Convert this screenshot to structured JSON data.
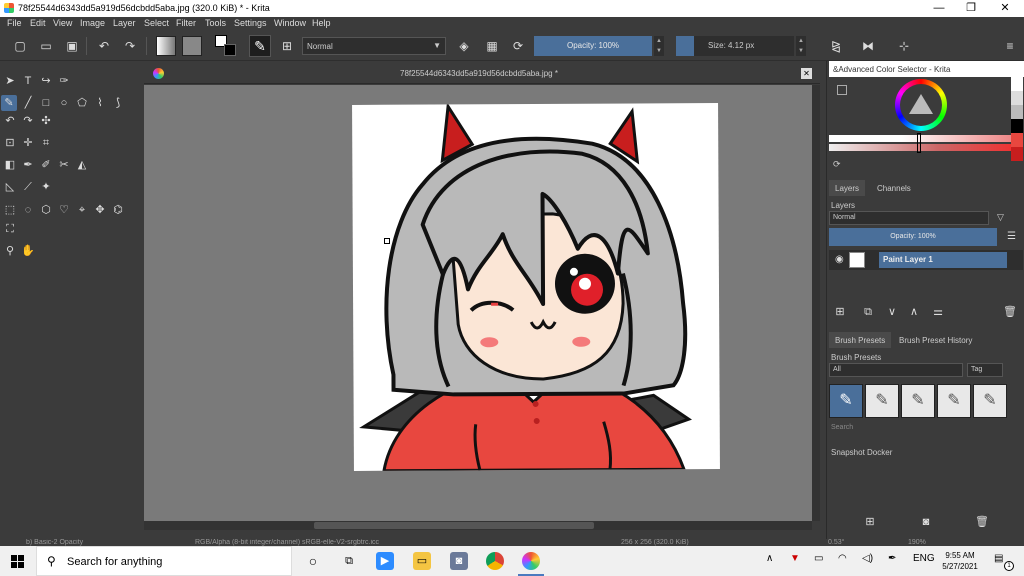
{
  "window": {
    "title": "78f25544d6343dd5a919d56dcbdd5aba.jpg (320.0 KiB)  * - Krita",
    "minimize": "—",
    "maximize": "❐",
    "close": "✕"
  },
  "menu": [
    "File",
    "Edit",
    "View",
    "Image",
    "Layer",
    "Select",
    "Filter",
    "Tools",
    "Settings",
    "Window",
    "Help"
  ],
  "toolbar": {
    "blend_mode": "Normal",
    "opacity": "Opacity: 100%",
    "size": "Size: 4.12 px"
  },
  "document": {
    "tab_title": "78f25544d6343dd5a919d56dcbdd5aba.jpg *"
  },
  "color_selector": {
    "title": "&Advanced Color Selector - Krita"
  },
  "layers_docker": {
    "tabs": [
      "Layers",
      "Channels"
    ],
    "section_label": "Layers",
    "blend_mode": "Normal",
    "opacity": "Opacity:  100%",
    "layer_name": "Paint Layer 1"
  },
  "brush_presets": {
    "tabs": [
      "Brush Presets",
      "Brush Preset History"
    ],
    "section_label": "Brush Presets",
    "filter": "All",
    "tag": "Tag",
    "search_placeholder": "Search"
  },
  "snapshot": {
    "label": "Snapshot Docker"
  },
  "status": {
    "brush": "b) Basic-2 Opacity",
    "color_model": "RGB/Alpha (8-bit integer/channel)  sRGB-elle-V2-srgbtrc.icc",
    "dimensions": "256 x 256 (320.0 KiB)",
    "rotation": "0.53°",
    "zoom": "190%"
  },
  "taskbar": {
    "search_placeholder": "Search for anything",
    "language": "ENG",
    "time": "9:55 AM",
    "date": "5/27/2021",
    "notification_count": "1"
  },
  "colors": {
    "accent": "#4a6f9a",
    "panel": "#3b3b3b",
    "canvas_bg": "#7a7a7a",
    "hair": "#b9b9b9",
    "shirt": "#e8473f",
    "horn": "#c81e1e"
  }
}
